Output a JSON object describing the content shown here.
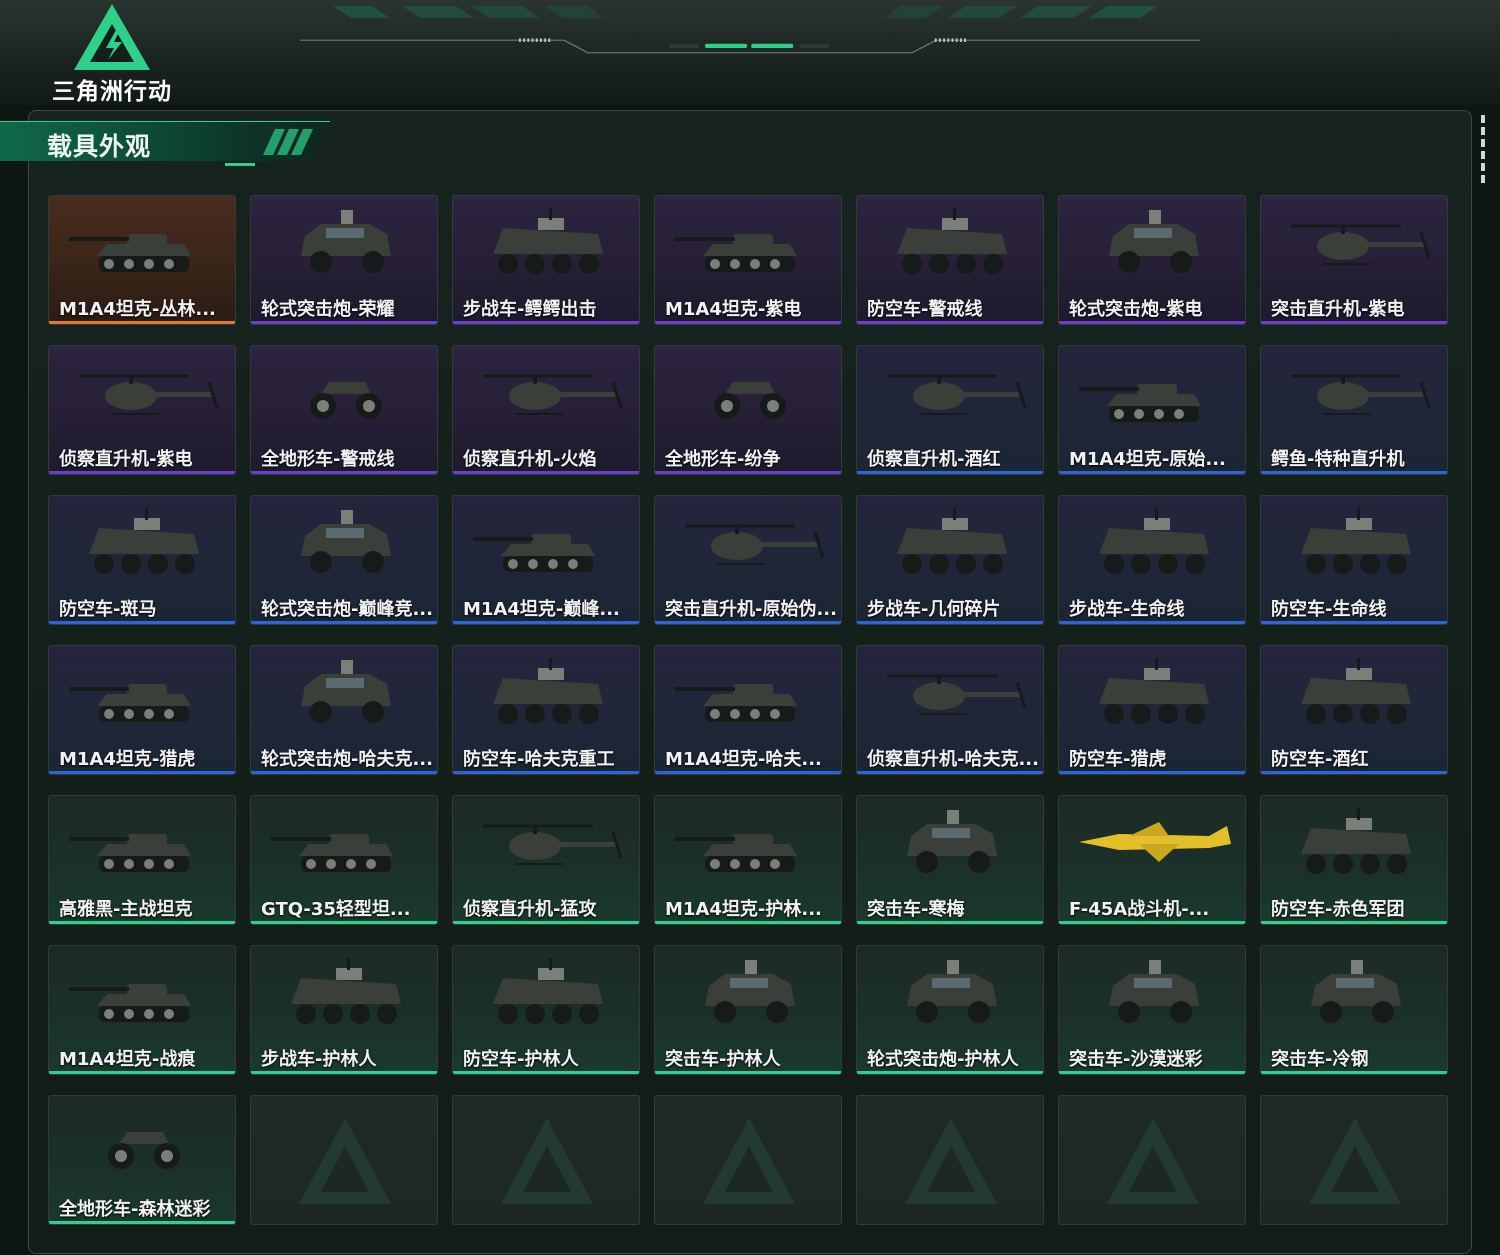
{
  "game": {
    "logo_text": "三角洲行动"
  },
  "section": {
    "title": "载具外观"
  },
  "colors": {
    "gold": "#e07a2c",
    "purple": "#6a3fd0",
    "blue": "#2f63d8",
    "green": "#2fd08a"
  },
  "items": [
    {
      "label": "M1A4坦克-丛林...",
      "rarity": "gold",
      "vehicle": "tank"
    },
    {
      "label": "轮式突击炮-荣耀",
      "rarity": "purple",
      "vehicle": "car"
    },
    {
      "label": "步战车-鳄鳄出击",
      "rarity": "purple",
      "vehicle": "apc"
    },
    {
      "label": "M1A4坦克-紫电",
      "rarity": "purple",
      "vehicle": "tank"
    },
    {
      "label": "防空车-警戒线",
      "rarity": "purple",
      "vehicle": "apc"
    },
    {
      "label": "轮式突击炮-紫电",
      "rarity": "purple",
      "vehicle": "car"
    },
    {
      "label": "突击直升机-紫电",
      "rarity": "purple",
      "vehicle": "heli"
    },
    {
      "label": "侦察直升机-紫电",
      "rarity": "purple",
      "vehicle": "heli"
    },
    {
      "label": "全地形车-警戒线",
      "rarity": "purple",
      "vehicle": "atv"
    },
    {
      "label": "侦察直升机-火焰",
      "rarity": "purple",
      "vehicle": "heli"
    },
    {
      "label": "全地形车-纷争",
      "rarity": "purple",
      "vehicle": "atv"
    },
    {
      "label": "侦察直升机-酒红",
      "rarity": "blue",
      "vehicle": "heli"
    },
    {
      "label": "M1A4坦克-原始...",
      "rarity": "blue",
      "vehicle": "tank"
    },
    {
      "label": "鳄鱼-特种直升机",
      "rarity": "blue",
      "vehicle": "heli"
    },
    {
      "label": "防空车-斑马",
      "rarity": "blue",
      "vehicle": "apc"
    },
    {
      "label": "轮式突击炮-巅峰竞...",
      "rarity": "blue",
      "vehicle": "car"
    },
    {
      "label": "M1A4坦克-巅峰...",
      "rarity": "blue",
      "vehicle": "tank"
    },
    {
      "label": "突击直升机-原始伪...",
      "rarity": "blue",
      "vehicle": "heli"
    },
    {
      "label": "步战车-几何碎片",
      "rarity": "blue",
      "vehicle": "apc"
    },
    {
      "label": "步战车-生命线",
      "rarity": "blue",
      "vehicle": "apc"
    },
    {
      "label": "防空车-生命线",
      "rarity": "blue",
      "vehicle": "apc"
    },
    {
      "label": "M1A4坦克-猎虎",
      "rarity": "blue",
      "vehicle": "tank"
    },
    {
      "label": "轮式突击炮-哈夫克...",
      "rarity": "blue",
      "vehicle": "car"
    },
    {
      "label": "防空车-哈夫克重工",
      "rarity": "blue",
      "vehicle": "apc"
    },
    {
      "label": "M1A4坦克-哈夫...",
      "rarity": "blue",
      "vehicle": "tank"
    },
    {
      "label": "侦察直升机-哈夫克...",
      "rarity": "blue",
      "vehicle": "heli"
    },
    {
      "label": "防空车-猎虎",
      "rarity": "blue",
      "vehicle": "apc"
    },
    {
      "label": "防空车-酒红",
      "rarity": "blue",
      "vehicle": "apc"
    },
    {
      "label": "高雅黑-主战坦克",
      "rarity": "green",
      "vehicle": "tank"
    },
    {
      "label": "GTQ-35轻型坦...",
      "rarity": "green",
      "vehicle": "tank"
    },
    {
      "label": "侦察直升机-猛攻",
      "rarity": "green",
      "vehicle": "heli"
    },
    {
      "label": "M1A4坦克-护林...",
      "rarity": "green",
      "vehicle": "tank"
    },
    {
      "label": "突击车-寒梅",
      "rarity": "green",
      "vehicle": "car"
    },
    {
      "label": "F-45A战斗机-...",
      "rarity": "green",
      "vehicle": "jet"
    },
    {
      "label": "防空车-赤色军团",
      "rarity": "green",
      "vehicle": "apc"
    },
    {
      "label": "M1A4坦克-战痕",
      "rarity": "green",
      "vehicle": "tank"
    },
    {
      "label": "步战车-护林人",
      "rarity": "green",
      "vehicle": "apc"
    },
    {
      "label": "防空车-护林人",
      "rarity": "green",
      "vehicle": "apc"
    },
    {
      "label": "突击车-护林人",
      "rarity": "green",
      "vehicle": "car"
    },
    {
      "label": "轮式突击炮-护林人",
      "rarity": "green",
      "vehicle": "car"
    },
    {
      "label": "突击车-沙漠迷彩",
      "rarity": "green",
      "vehicle": "car"
    },
    {
      "label": "突击车-冷钢",
      "rarity": "green",
      "vehicle": "car"
    },
    {
      "label": "全地形车-森林迷彩",
      "rarity": "green",
      "vehicle": "atv"
    },
    {
      "label": "",
      "rarity": "empty",
      "vehicle": "none"
    },
    {
      "label": "",
      "rarity": "empty",
      "vehicle": "none"
    },
    {
      "label": "",
      "rarity": "empty",
      "vehicle": "none"
    },
    {
      "label": "",
      "rarity": "empty",
      "vehicle": "none"
    },
    {
      "label": "",
      "rarity": "empty",
      "vehicle": "none"
    },
    {
      "label": "",
      "rarity": "empty",
      "vehicle": "none"
    }
  ]
}
